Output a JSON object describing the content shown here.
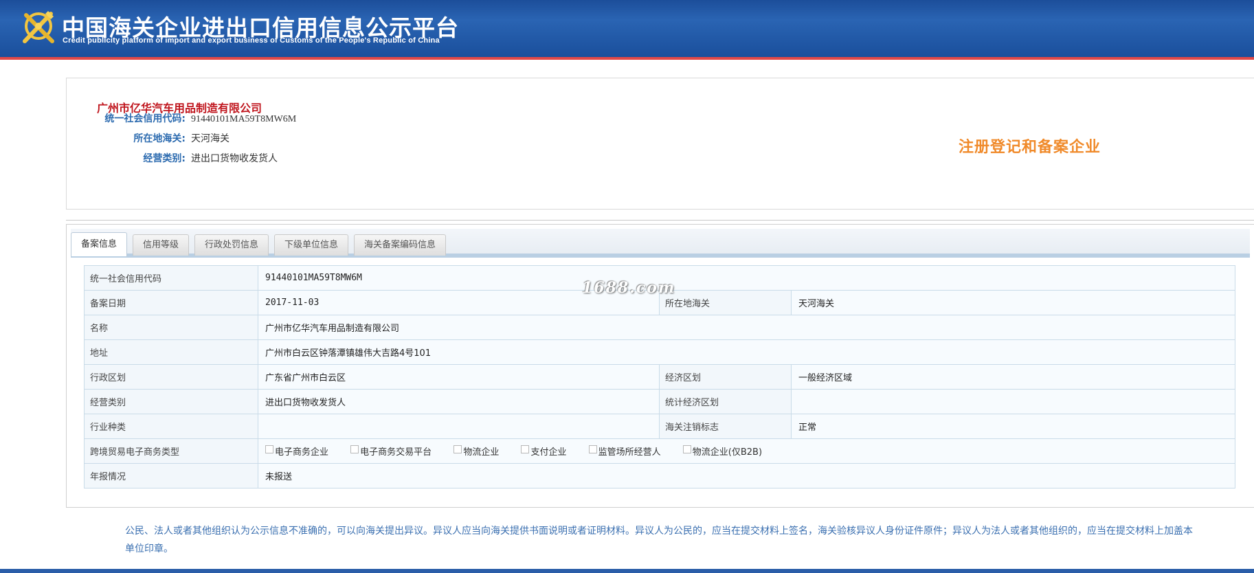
{
  "header": {
    "title": "中国海关企业进出口信用信息公示平台",
    "subtitle": "Credit publicity platform of import and export business of Customs of the People's Republic of China",
    "logo_icon": "customs-emblem-icon"
  },
  "company": {
    "name": "广州市亿华汽车用品制造有限公司",
    "fields": [
      {
        "label": "统一社会信用代码:",
        "value": "91440101MA59T8MW6M"
      },
      {
        "label": "所在地海关:",
        "value": "天河海关"
      },
      {
        "label": "经营类别:",
        "value": "进出口货物收发货人"
      }
    ],
    "status": "注册登记和备案企业"
  },
  "tabs": [
    {
      "label": "备案信息",
      "active": true
    },
    {
      "label": "信用等级",
      "active": false
    },
    {
      "label": "行政处罚信息",
      "active": false
    },
    {
      "label": "下级单位信息",
      "active": false
    },
    {
      "label": "海关备案编码信息",
      "active": false
    }
  ],
  "table": {
    "credit_code_label": "统一社会信用代码",
    "credit_code": "91440101MA59T8MW6M",
    "reg_date_label": "备案日期",
    "reg_date": "2017-11-03",
    "customs_label": "所在地海关",
    "customs": "天河海关",
    "name_label": "名称",
    "name": "广州市亿华汽车用品制造有限公司",
    "address_label": "地址",
    "address": "广州市白云区钟落潭镇雄伟大吉路4号101",
    "admin_region_label": "行政区划",
    "admin_region": "广东省广州市白云区",
    "econ_region_label": "经济区划",
    "econ_region": "一般经济区域",
    "business_type_label": "经营类别",
    "business_type": "进出口货物收发货人",
    "stat_region_label": "统计经济区划",
    "stat_region": "",
    "industry_label": "行业种类",
    "industry": "",
    "cancel_flag_label": "海关注销标志",
    "cancel_flag": "正常",
    "ecommerce_label": "跨境贸易电子商务类型",
    "ecommerce_options": [
      {
        "label": "电子商务企业",
        "checked": false
      },
      {
        "label": "电子商务交易平台",
        "checked": false
      },
      {
        "label": "物流企业",
        "checked": false
      },
      {
        "label": "支付企业",
        "checked": false
      },
      {
        "label": "监管场所经营人",
        "checked": false
      },
      {
        "label": "物流企业(仅B2B)",
        "checked": false
      }
    ],
    "annual_report_label": "年报情况",
    "annual_report": "未报送"
  },
  "watermark": "1688.com",
  "notice": "公民、法人或者其他组织认为公示信息不准确的，可以向海关提出异议。异议人应当向海关提供书面说明或者证明材料。异议人为公民的，应当在提交材料上签名，海关验核异议人身份证件原件；异议人为法人或者其他组织的，应当在提交材料上加盖本单位印章。",
  "colors": {
    "header_bg": "#1c4e9a",
    "accent_red": "#c0161e",
    "label_blue": "#2b6aaf",
    "status_orange": "#f08a2a"
  }
}
